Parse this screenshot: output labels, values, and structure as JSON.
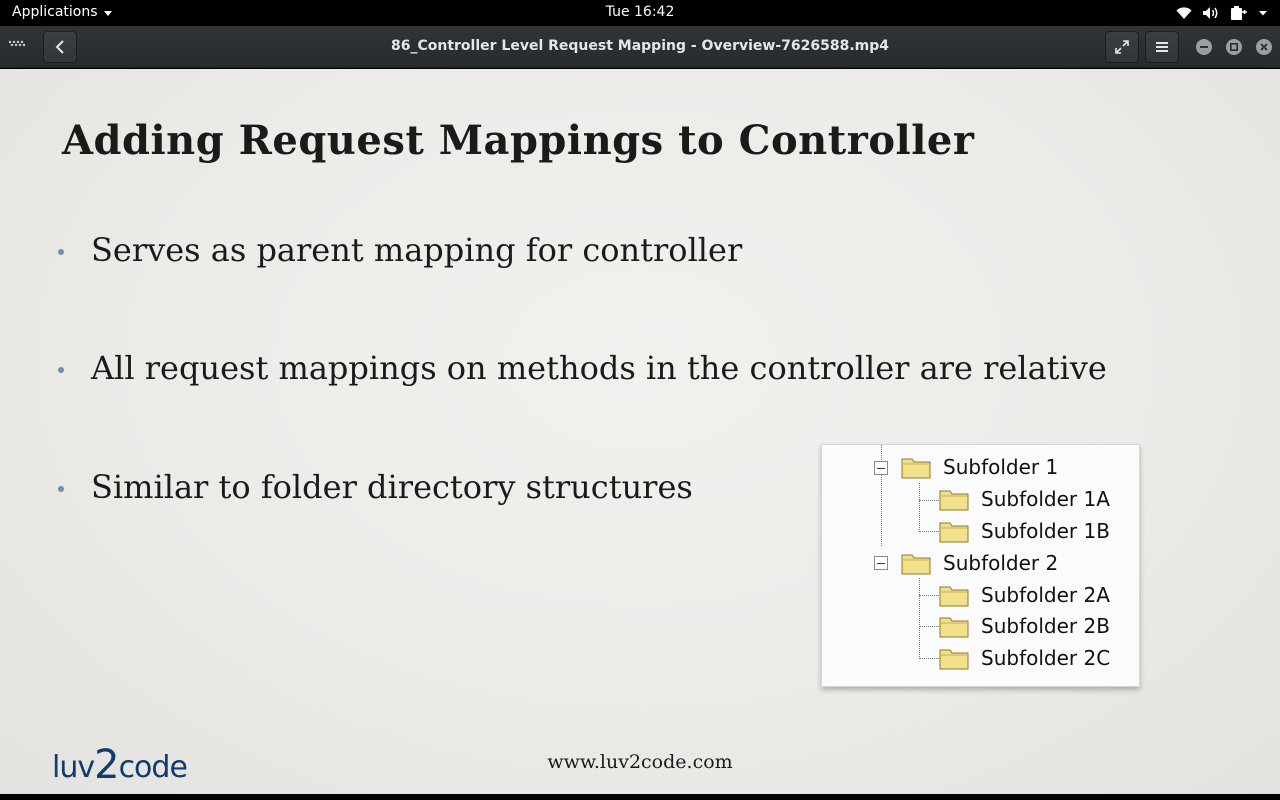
{
  "topbar": {
    "applications_label": "Applications",
    "clock": "Tue 16:42"
  },
  "player": {
    "title": "86_Controller Level Request Mapping - Overview-7626588.mp4"
  },
  "slide": {
    "title": "Adding Request Mappings to Controller",
    "bullets": [
      "Serves as parent mapping for controller",
      "All request mappings on methods in the controller are relative",
      "Similar to folder directory structures"
    ],
    "tree": [
      "Subfolder 1",
      "Subfolder 1A",
      "Subfolder 1B",
      "Subfolder 2",
      "Subfolder 2A",
      "Subfolder 2B",
      "Subfolder 2C"
    ],
    "logo_text_left": "luv",
    "logo_text_digit": "2",
    "logo_text_right": "code",
    "footer_url": "www.luv2code.com"
  },
  "colors": {
    "accent_bullet": "#6f8fb3",
    "logo": "#0d3c6e",
    "folder": "#f3e08a"
  }
}
